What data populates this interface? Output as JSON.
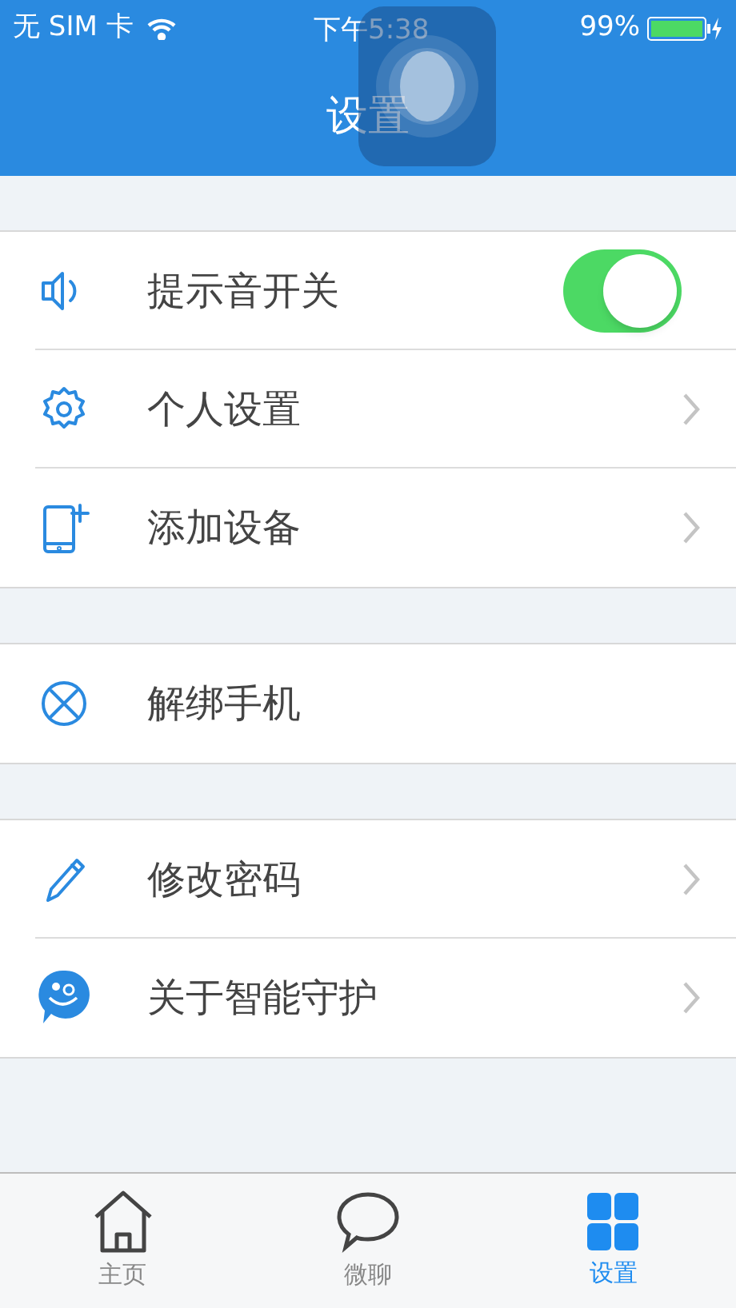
{
  "status_bar": {
    "carrier": "无 SIM 卡",
    "time": "下午5:38",
    "battery": "99%"
  },
  "nav": {
    "title": "设置"
  },
  "groups": [
    {
      "items": [
        {
          "label": "提示音开关",
          "kind": "toggle",
          "on": true
        },
        {
          "label": "个人设置",
          "kind": "link"
        },
        {
          "label": "添加设备",
          "kind": "link"
        }
      ]
    },
    {
      "items": [
        {
          "label": "解绑手机",
          "kind": "action"
        }
      ]
    },
    {
      "items": [
        {
          "label": "修改密码",
          "kind": "link"
        },
        {
          "label": "关于智能守护",
          "kind": "link"
        }
      ]
    }
  ],
  "tab_bar": [
    {
      "label": "主页",
      "selected": false
    },
    {
      "label": "微聊",
      "selected": false
    },
    {
      "label": "设置",
      "selected": true
    }
  ]
}
